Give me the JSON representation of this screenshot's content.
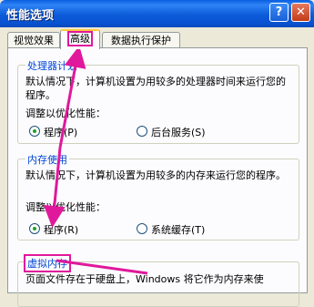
{
  "window": {
    "title": "性能选项",
    "help_glyph": "?",
    "close_glyph": "✕"
  },
  "tabs": [
    {
      "label": "视觉效果",
      "active": false
    },
    {
      "label": "高级",
      "active": true
    },
    {
      "label": "数据执行保护",
      "active": false
    }
  ],
  "processor": {
    "legend": "处理器计划",
    "description": "默认情况下，计算机设置为用较多的处理器时间来运行您的程序。",
    "adjust_label": "调整以优化性能：",
    "options": [
      {
        "label": "程序(P)",
        "checked": true
      },
      {
        "label": "后台服务(S)",
        "checked": false
      }
    ]
  },
  "memory": {
    "legend": "内存使用",
    "description": "默认情况下，计算机设置为用较多的内存来运行您的程序。",
    "adjust_label": "调整以优化性能：",
    "options": [
      {
        "label": "程序(R)",
        "checked": true
      },
      {
        "label": "系统缓存(T)",
        "checked": false
      }
    ]
  },
  "virtual_memory": {
    "legend": "虚拟内存",
    "description": "页面文件存在于硬盘上，Windows 将它作为内存来使"
  },
  "colors": {
    "annotation": "#E0189C",
    "titlebar": "#0A5FE0",
    "legend_text": "#0046D5"
  }
}
